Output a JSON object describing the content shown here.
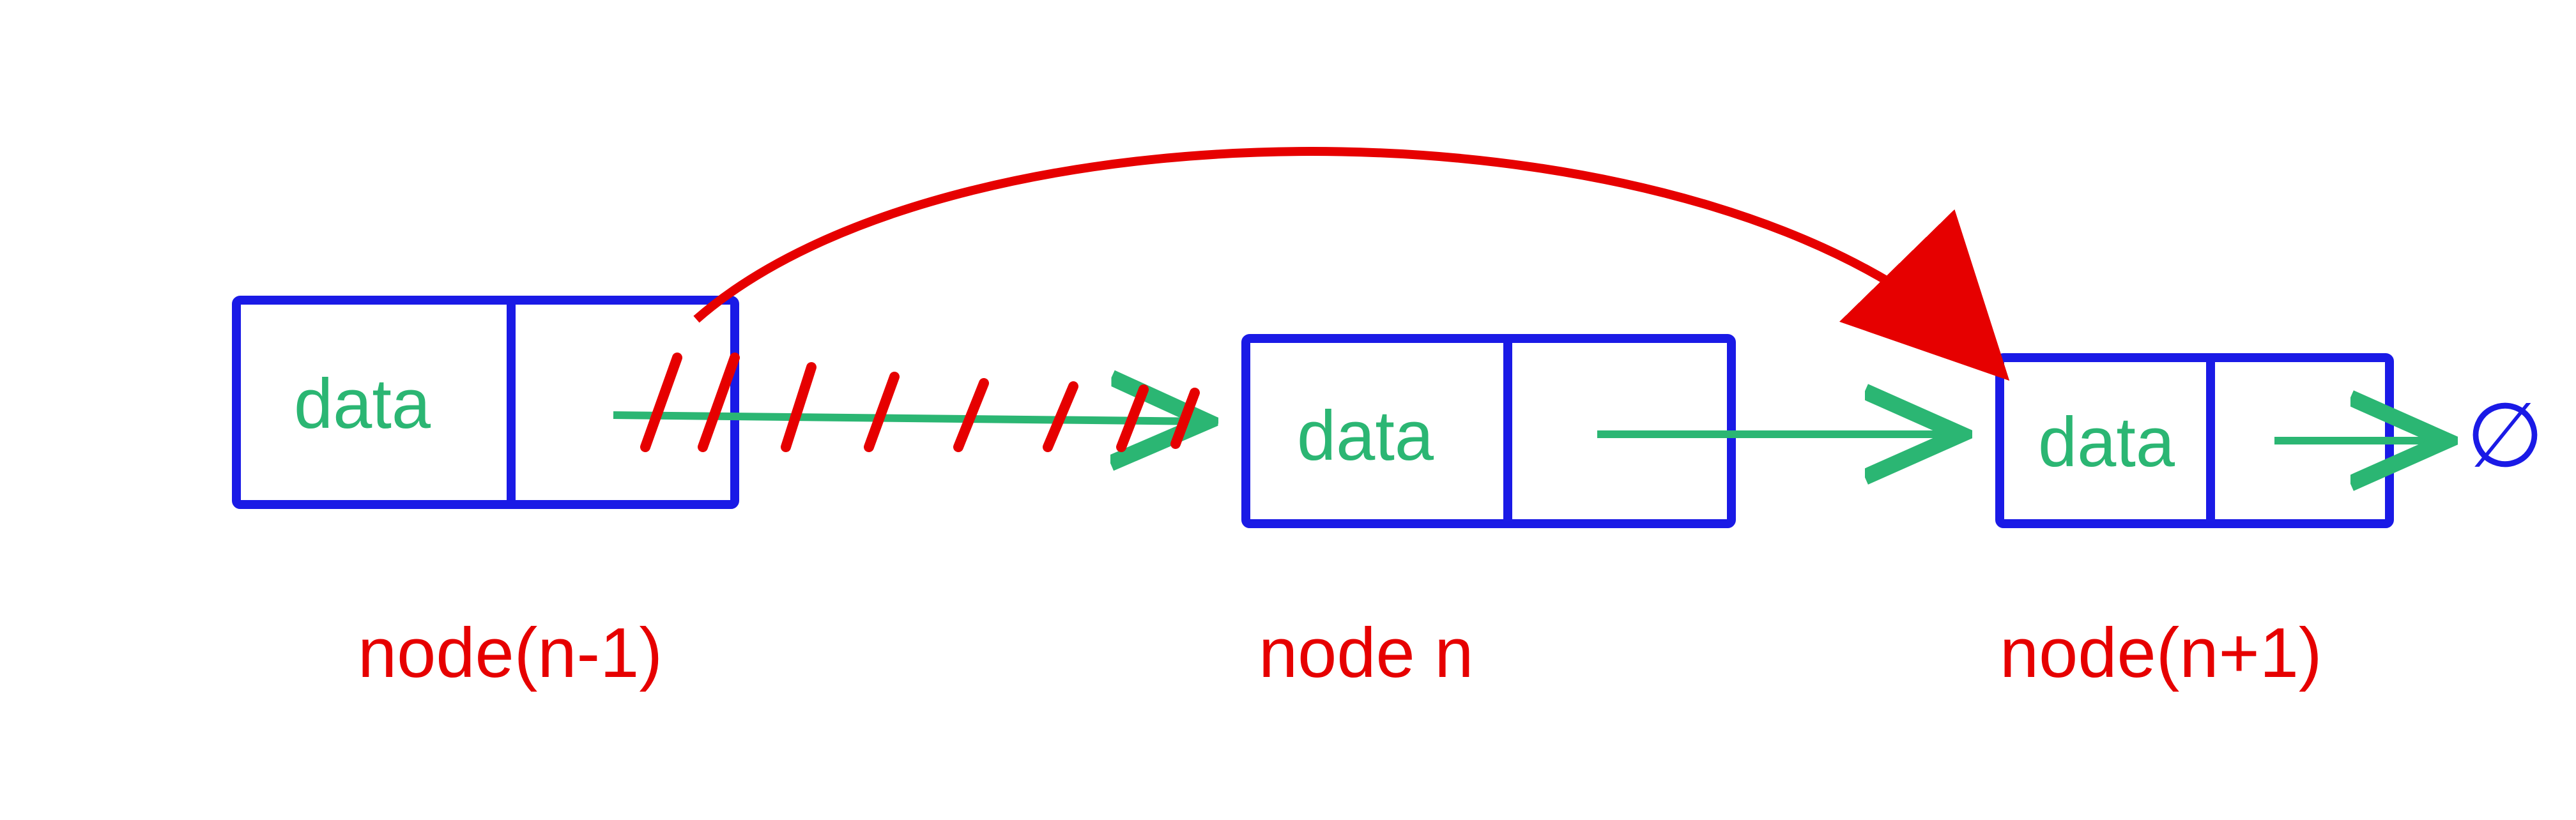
{
  "diagram": {
    "node_prev": {
      "data_label": "data",
      "caption": "node(n-1)"
    },
    "node_curr": {
      "data_label": "data",
      "caption": "node n"
    },
    "node_next": {
      "data_label": "data",
      "caption": "node(n+1)"
    },
    "null_symbol": "∅",
    "colors": {
      "box_stroke": "#1a1ae6",
      "data_text": "#2bb673",
      "pointer_arrow": "#2bb673",
      "bypass_arrow": "#e60000",
      "strike": "#e60000",
      "label": "#e60000"
    }
  }
}
